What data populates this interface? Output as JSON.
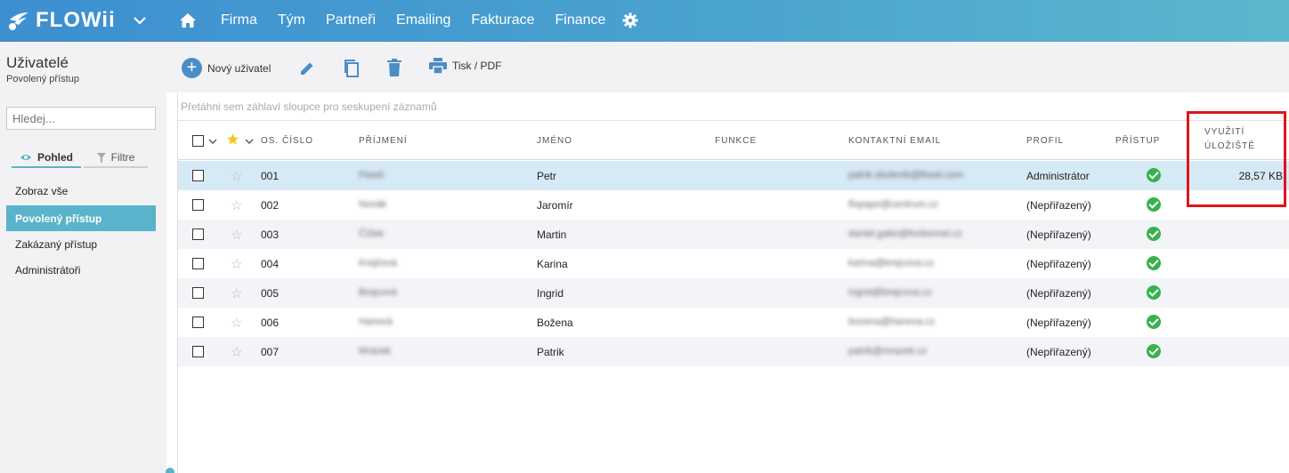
{
  "app": {
    "logo": "FLOWii"
  },
  "nav": {
    "items": [
      "Firma",
      "Tým",
      "Partneři",
      "Emailing",
      "Fakturace",
      "Finance"
    ]
  },
  "left": {
    "title": "Uživatelé",
    "subtitle": "Povolený přístup",
    "search_placeholder": "Hledej...",
    "tab_view": "Pohled",
    "tab_filters": "Filtre",
    "items": [
      "Zobraz vše",
      "Povolený přístup",
      "Zakázaný přístup",
      "Administrátoři"
    ]
  },
  "toolbar": {
    "new_user": "Nový uživatel",
    "print": "Tisk / PDF"
  },
  "grid": {
    "group_hint": "Přetáhni sem záhlaví sloupce pro seskupení záznamů",
    "columns": {
      "number": "Os. číslo",
      "surname": "Příjmení",
      "name": "Jméno",
      "function": "Funkce",
      "email": "Kontaktní email",
      "profile": "Profil",
      "access": "Přístup",
      "storage_1": "Využití",
      "storage_2": "úložiště"
    },
    "rows": [
      {
        "number": "001",
        "surname": "Flowii",
        "name": "Petr",
        "email": "patrik.skolenik@flowii.com",
        "profile": "Administrátor",
        "storage": "28,57 KB"
      },
      {
        "number": "002",
        "surname": "Novák",
        "name": "Jaromír",
        "email": "flopapo@centrum.cz",
        "profile": "(Nepřiřazený)",
        "storage": ""
      },
      {
        "number": "003",
        "surname": "Čížek",
        "name": "Martin",
        "email": "daniel.gabo@fortionnet.cz",
        "profile": "(Nepřiřazený)",
        "storage": ""
      },
      {
        "number": "004",
        "surname": "Krejčová",
        "name": "Karina",
        "email": "karina@krejcova.cz",
        "profile": "(Nepřiřazený)",
        "storage": ""
      },
      {
        "number": "005",
        "surname": "Brejcová",
        "name": "Ingrid",
        "email": "ingrid@brejcova.cz",
        "profile": "(Nepřiřazený)",
        "storage": ""
      },
      {
        "number": "006",
        "surname": "Hanová",
        "name": "Božena",
        "email": "bozena@hanova.cz",
        "profile": "(Nepřiřazený)",
        "storage": ""
      },
      {
        "number": "007",
        "surname": "Mrázek",
        "name": "Patrik",
        "email": "patrik@mrazek.cz",
        "profile": "(Nepřiřazený)",
        "storage": ""
      }
    ]
  },
  "colors": {
    "accent": "#5ab3cb",
    "topbar_start": "#3d8fd0",
    "highlight": "#e0141b",
    "ok": "#37b24d"
  }
}
